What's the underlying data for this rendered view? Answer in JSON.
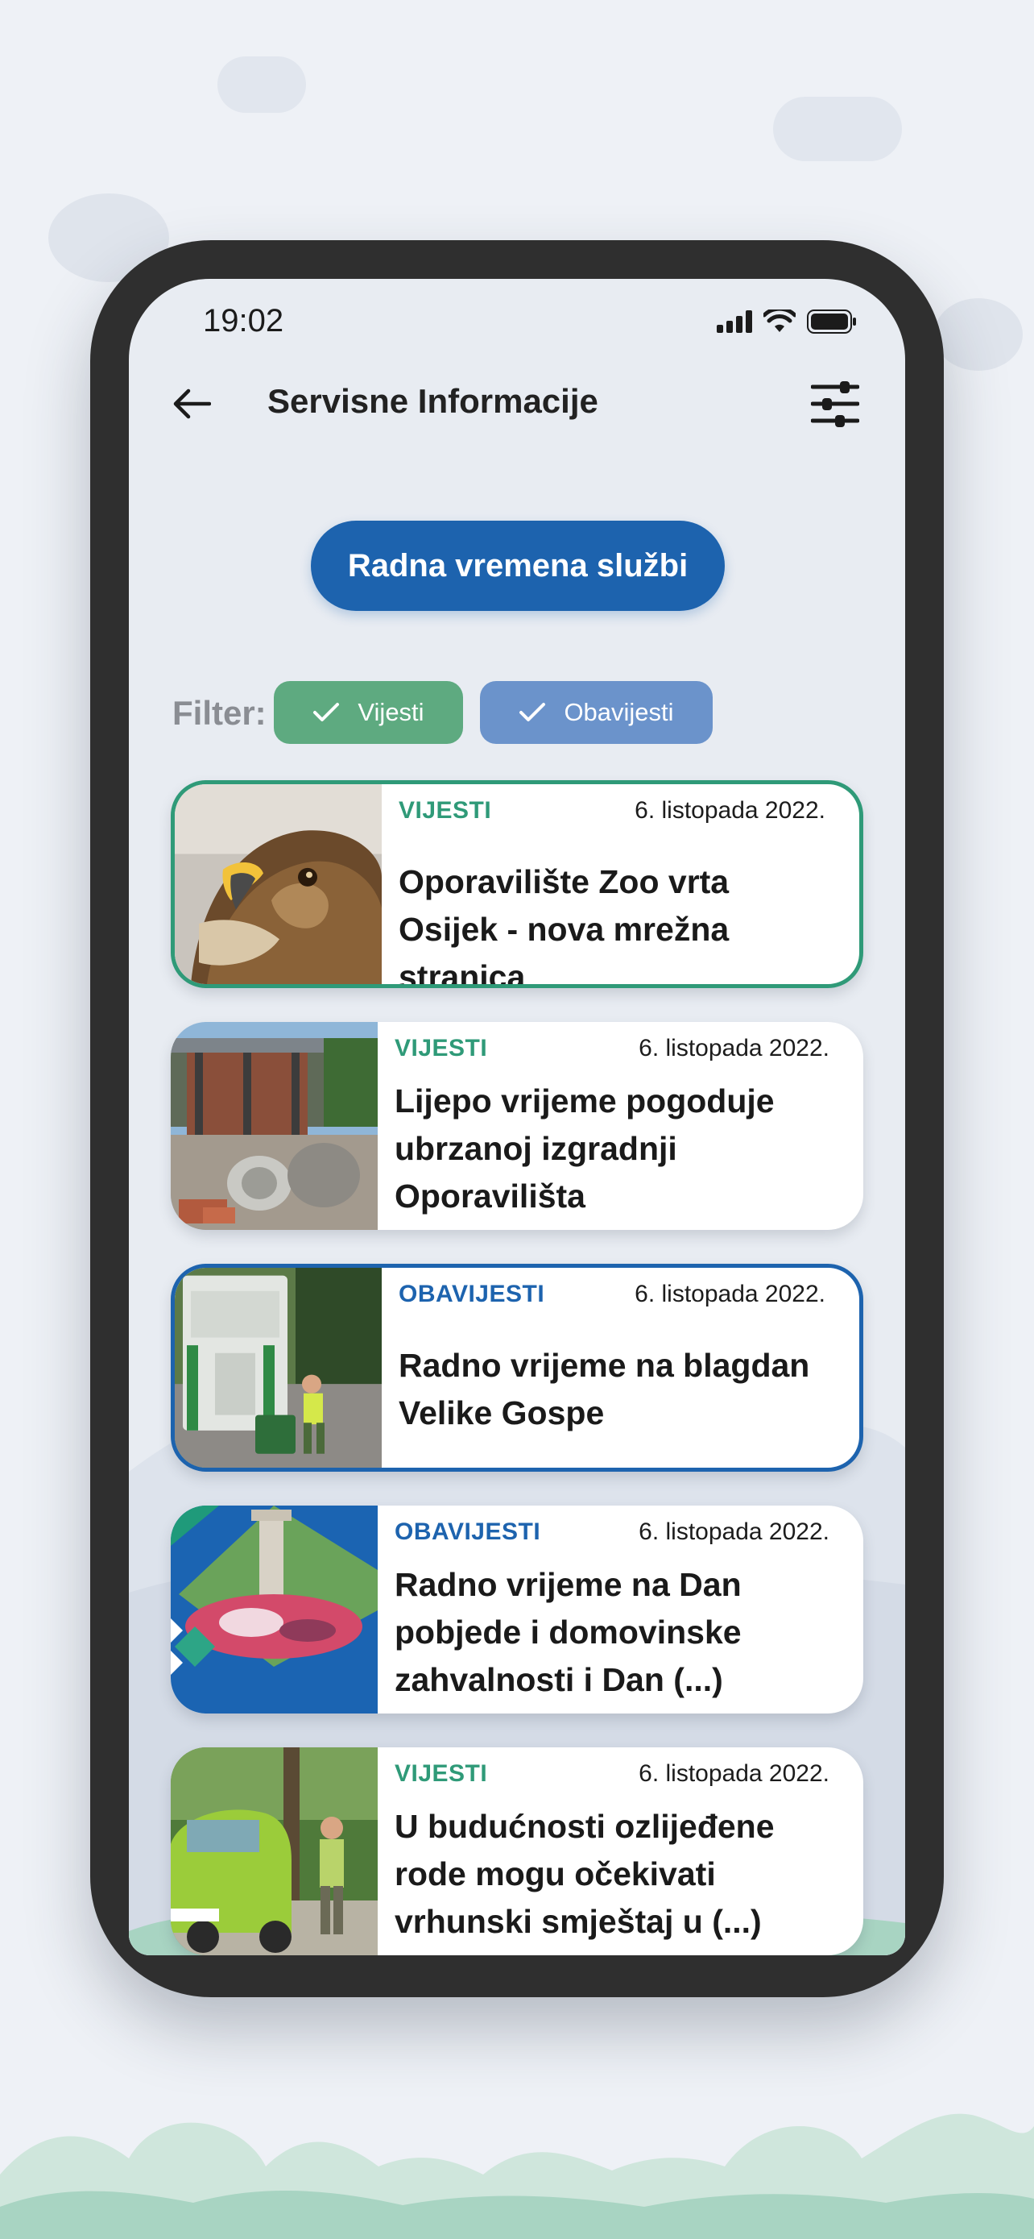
{
  "status_bar": {
    "time": "19:02"
  },
  "header": {
    "title": "Servisne Informacije"
  },
  "primary_button": {
    "label": "Radna vremena službi"
  },
  "filter": {
    "label": "Filter:",
    "chips": [
      {
        "label": "Vijesti",
        "checked": true,
        "color": "#5eaa80"
      },
      {
        "label": "Obavijesti",
        "checked": true,
        "color": "#6b93cb"
      }
    ]
  },
  "colors": {
    "primary": "#1d63ae",
    "news_accent": "#2f9a78",
    "notice_accent": "#1d63ae"
  },
  "cards": [
    {
      "category": "VIJESTI",
      "date": "6. listopada 2022.",
      "title": "Oporavilište Zoo vrta Osijek - nova mrežna stranica",
      "thumbnail": "eagle-photo"
    },
    {
      "category": "VIJESTI",
      "date": "6. listopada 2022.",
      "title": "Lijepo vrijeme pogoduje ubrzanoj izgradnji Oporavilišta",
      "thumbnail": "construction-photo"
    },
    {
      "category": "OBAVIJESTI",
      "date": "6. listopada 2022.",
      "title": "Radno vrijeme na blagdan Velike Gospe",
      "thumbnail": "garbage-truck-photo"
    },
    {
      "category": "OBAVIJESTI",
      "date": "6. listopada 2022.",
      "title": "Radno vrijeme na Dan pobjede i domovinske zahvalnosti i Dan (...)",
      "thumbnail": "flowers-monument-photo"
    },
    {
      "category": "VIJESTI",
      "date": "6. listopada 2022.",
      "title": "U budućnosti ozlijeđene rode mogu očekivati vrhunski smještaj u (...)",
      "thumbnail": "car-stork-photo"
    }
  ]
}
